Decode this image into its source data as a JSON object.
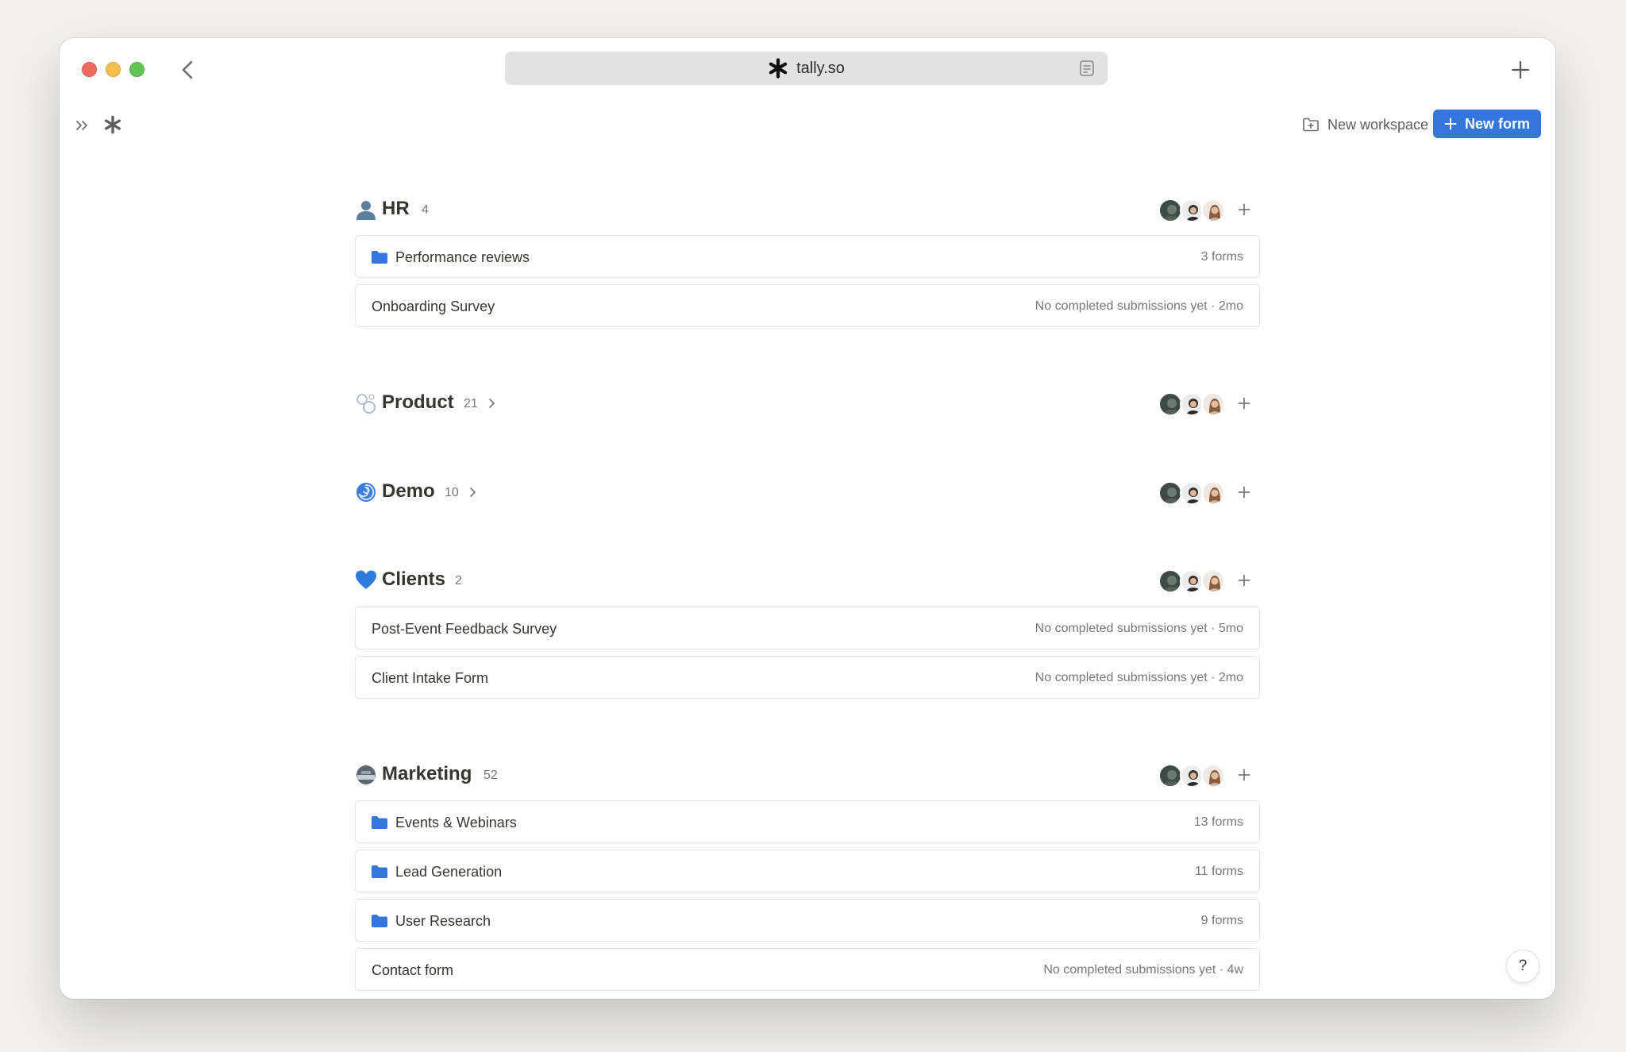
{
  "browser": {
    "url": "tally.so"
  },
  "toolbar": {
    "new_workspace_label": "New workspace",
    "new_form_label": "New form",
    "accent": "#3476d9"
  },
  "workspaces": [
    {
      "name": "HR",
      "count": "4",
      "icon": "person-silhouette-emoji",
      "collapsed": false,
      "items": [
        {
          "kind": "folder",
          "label": "Performance reviews",
          "meta": "3 forms"
        },
        {
          "kind": "form",
          "label": "Onboarding Survey",
          "meta": "No completed submissions yet · 2mo"
        }
      ]
    },
    {
      "name": "Product",
      "count": "21",
      "icon": "bubbles-emoji",
      "collapsed": true,
      "items": []
    },
    {
      "name": "Demo",
      "count": "10",
      "icon": "cyclone-emoji",
      "collapsed": true,
      "items": []
    },
    {
      "name": "Clients",
      "count": "2",
      "icon": "blue-heart-emoji",
      "collapsed": false,
      "items": [
        {
          "kind": "form",
          "label": "Post-Event Feedback Survey",
          "meta": "No completed submissions yet · 5mo"
        },
        {
          "kind": "form",
          "label": "Client Intake Form",
          "meta": "No completed submissions yet · 2mo"
        }
      ]
    },
    {
      "name": "Marketing",
      "count": "52",
      "icon": "satellite-dish-emoji",
      "collapsed": false,
      "items": [
        {
          "kind": "folder",
          "label": "Events & Webinars",
          "meta": "13 forms"
        },
        {
          "kind": "folder",
          "label": "Lead Generation",
          "meta": "11 forms"
        },
        {
          "kind": "folder",
          "label": "User Research",
          "meta": "9 forms"
        },
        {
          "kind": "form",
          "label": "Contact form",
          "meta": "No completed submissions yet · 4w"
        }
      ]
    }
  ],
  "help": {
    "label": "?"
  }
}
